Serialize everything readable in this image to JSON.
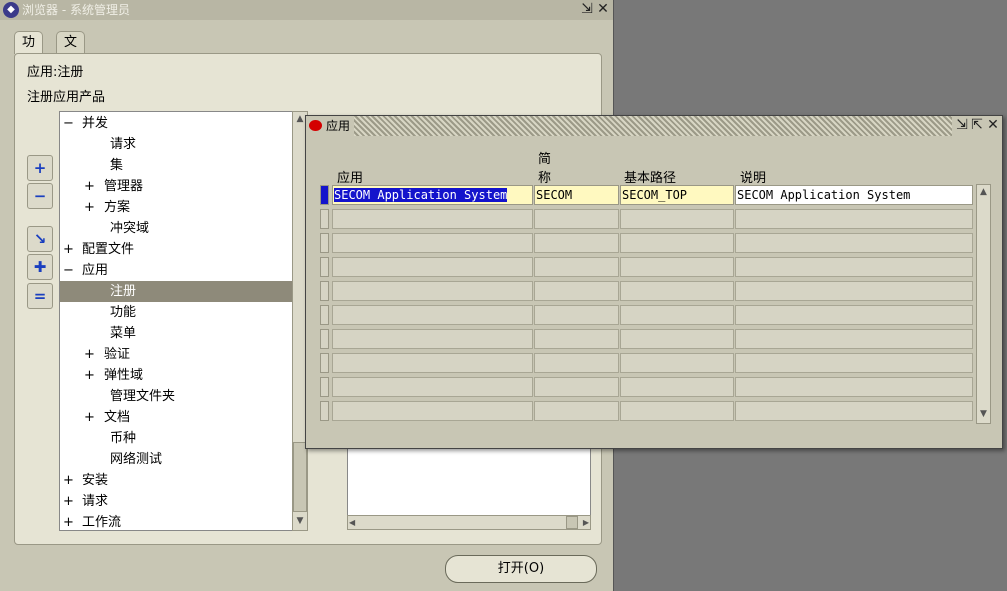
{
  "navigator": {
    "title": "浏览器 - 系统管理员",
    "tabs": [
      "功能",
      "文档"
    ],
    "breadcrumb": "应用:注册",
    "section_label": "注册应用产品",
    "tree": [
      {
        "prefix": "−",
        "label": "并发"
      },
      {
        "prefix": "",
        "label": "请求"
      },
      {
        "prefix": "",
        "label": "集"
      },
      {
        "prefix": "+",
        "label": "管理器"
      },
      {
        "prefix": "+",
        "label": "方案"
      },
      {
        "prefix": "",
        "label": "冲突域"
      },
      {
        "prefix": "+",
        "label": "配置文件"
      },
      {
        "prefix": "−",
        "label": "应用"
      },
      {
        "prefix": "",
        "label": "注册"
      },
      {
        "prefix": "",
        "label": "功能"
      },
      {
        "prefix": "",
        "label": "菜单"
      },
      {
        "prefix": "+",
        "label": "验证"
      },
      {
        "prefix": "+",
        "label": "弹性域"
      },
      {
        "prefix": "",
        "label": "管理文件夹"
      },
      {
        "prefix": "+",
        "label": "文档"
      },
      {
        "prefix": "",
        "label": "币种"
      },
      {
        "prefix": "",
        "label": "网络测试"
      },
      {
        "prefix": "+",
        "label": "安装"
      },
      {
        "prefix": "+",
        "label": "请求"
      },
      {
        "prefix": "+",
        "label": "工作流"
      }
    ],
    "selected_item": "注册",
    "open_button": "打开(O)"
  },
  "app_dialog": {
    "title": "应用",
    "headers": {
      "app": "应用",
      "short_name_l1": "简",
      "short_name_l2": "称",
      "base_path": "基本路径",
      "description": "说明"
    },
    "rows": [
      {
        "app": "SECOM Application System",
        "short_name": "SECOM",
        "base_path": "SECOM_TOP",
        "description": "SECOM Application System"
      }
    ],
    "empty_rows": 9
  },
  "colors": {
    "selection": "#1414cc",
    "required_field": "#fff9c0",
    "dialog_logo": "#d40000"
  }
}
